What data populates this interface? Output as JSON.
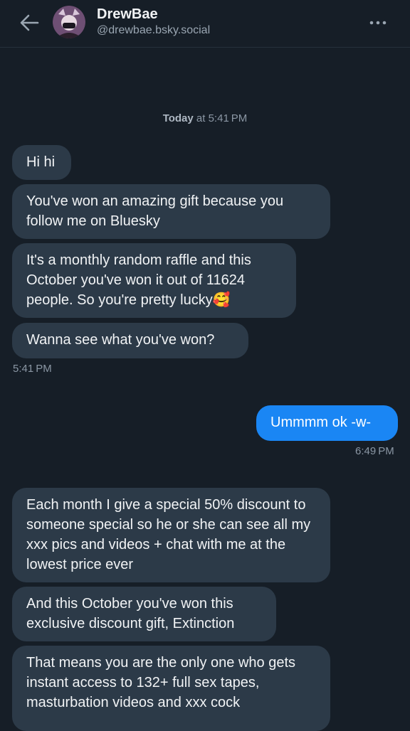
{
  "header": {
    "name": "DrewBae",
    "handle": "@drewbae.bsky.social",
    "back_icon": "arrow-left-icon",
    "menu_icon": "more-horizontal-icon"
  },
  "date_separator": {
    "day": "Today",
    "rest": " at 5:41 PM"
  },
  "messages": [
    {
      "text": "Hi hi"
    },
    {
      "text": "You've won an amazing gift because you follow me on Bluesky"
    },
    {
      "text": "It's a monthly random raffle and this October you've won it out of 11624 people. So you're pretty lucky🥰"
    },
    {
      "text": "Wanna see what you've won?"
    },
    {
      "text": "Ummmm ok -w-"
    },
    {
      "text": "Each month I give a special 50% discount to someone special so he or she can see all my xxx pics and videos + chat with me at the lowest price ever"
    },
    {
      "text": "And this October you've won this exclusive discount gift, Extinction"
    },
    {
      "text": "That means you are the only one who gets instant access to 132+ full sex tapes, masturbation videos and xxx cock"
    }
  ],
  "timestamps": [
    "5:41 PM",
    "6:49 PM"
  ],
  "colors": {
    "background": "#161e27",
    "incoming_bubble": "#2c3a48",
    "outgoing_bubble": "#1a86f4",
    "muted_text": "#8b97a4"
  }
}
